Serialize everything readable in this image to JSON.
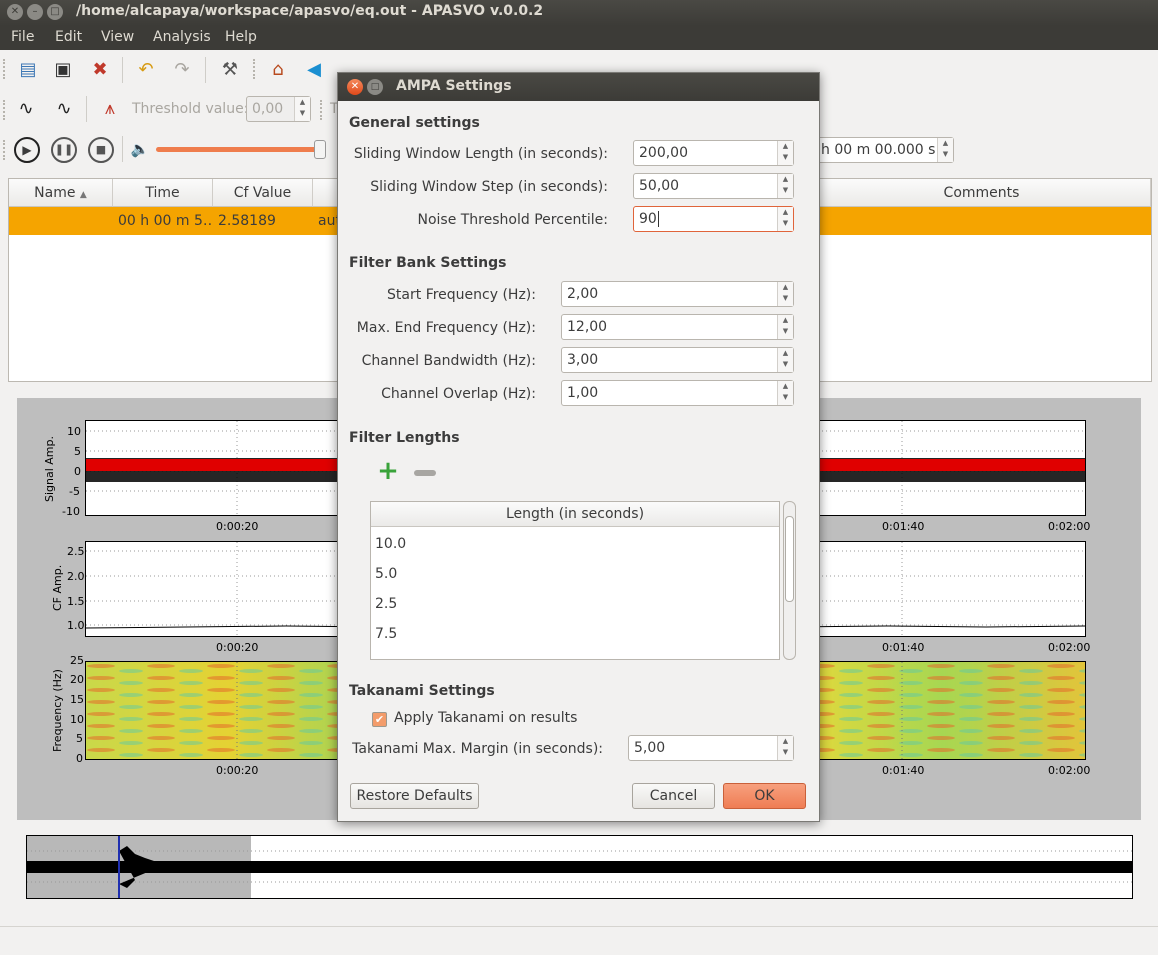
{
  "window": {
    "title": "/home/alcapaya/workspace/apasvo/eq.out - APASVO v.0.0.2"
  },
  "menu": [
    "File",
    "Edit",
    "View",
    "Analysis",
    "Help"
  ],
  "toolbar": {
    "threshold_label": "Threshold value:",
    "threshold_value": "0,00",
    "partial_label": "T",
    "time_value": "h 00 m 00.000 s",
    "volume_level": 1.0
  },
  "table": {
    "columns": [
      "Name",
      "Time",
      "Cf Value",
      "",
      "Comments"
    ],
    "rows": [
      {
        "name": "",
        "time": "00 h 00 m 5…",
        "cf_value": "2.58189",
        "method": "aut"
      }
    ]
  },
  "plots": {
    "signal": {
      "ylabel": "Signal Amp.",
      "yticks": [
        "10",
        "5",
        "0",
        "-5",
        "-10"
      ],
      "xticks": [
        "0:00:20",
        "0:01:40",
        "0:02:00"
      ]
    },
    "cf": {
      "ylabel": "CF Amp.",
      "yticks": [
        "2.5",
        "2.0",
        "1.5",
        "1.0"
      ],
      "xticks": [
        "0:00:20",
        "0:01:40",
        "0:02:00"
      ]
    },
    "spectrogram": {
      "ylabel": "Frequency (Hz)",
      "yticks": [
        "25",
        "20",
        "15",
        "10",
        "5",
        "0"
      ],
      "xticks": [
        "0:00:20",
        "0:01:40",
        "0:02:00"
      ]
    }
  },
  "dialog": {
    "title": "AMPA Settings",
    "general": {
      "heading": "General settings",
      "window_length_label": "Sliding Window Length (in seconds):",
      "window_length": "200,00",
      "window_step_label": "Sliding Window Step (in seconds):",
      "window_step": "50,00",
      "noise_label": "Noise Threshold Percentile:",
      "noise": "90"
    },
    "filter_bank": {
      "heading": "Filter Bank Settings",
      "start_freq_label": "Start Frequency (Hz):",
      "start_freq": "2,00",
      "end_freq_label": "Max. End Frequency (Hz):",
      "end_freq": "12,00",
      "bandwidth_label": "Channel Bandwidth (Hz):",
      "bandwidth": "3,00",
      "overlap_label": "Channel Overlap (Hz):",
      "overlap": "1,00"
    },
    "filter_lengths": {
      "heading": "Filter Lengths",
      "column": "Length (in seconds)",
      "items": [
        "10.0",
        "5.0",
        "2.5",
        "7.5"
      ]
    },
    "takanami": {
      "heading": "Takanami Settings",
      "apply_label": "Apply Takanami on results",
      "apply_checked": true,
      "margin_label": "Takanami Max. Margin (in seconds):",
      "margin": "5,00"
    },
    "buttons": {
      "restore": "Restore Defaults",
      "cancel": "Cancel",
      "ok": "OK"
    }
  }
}
